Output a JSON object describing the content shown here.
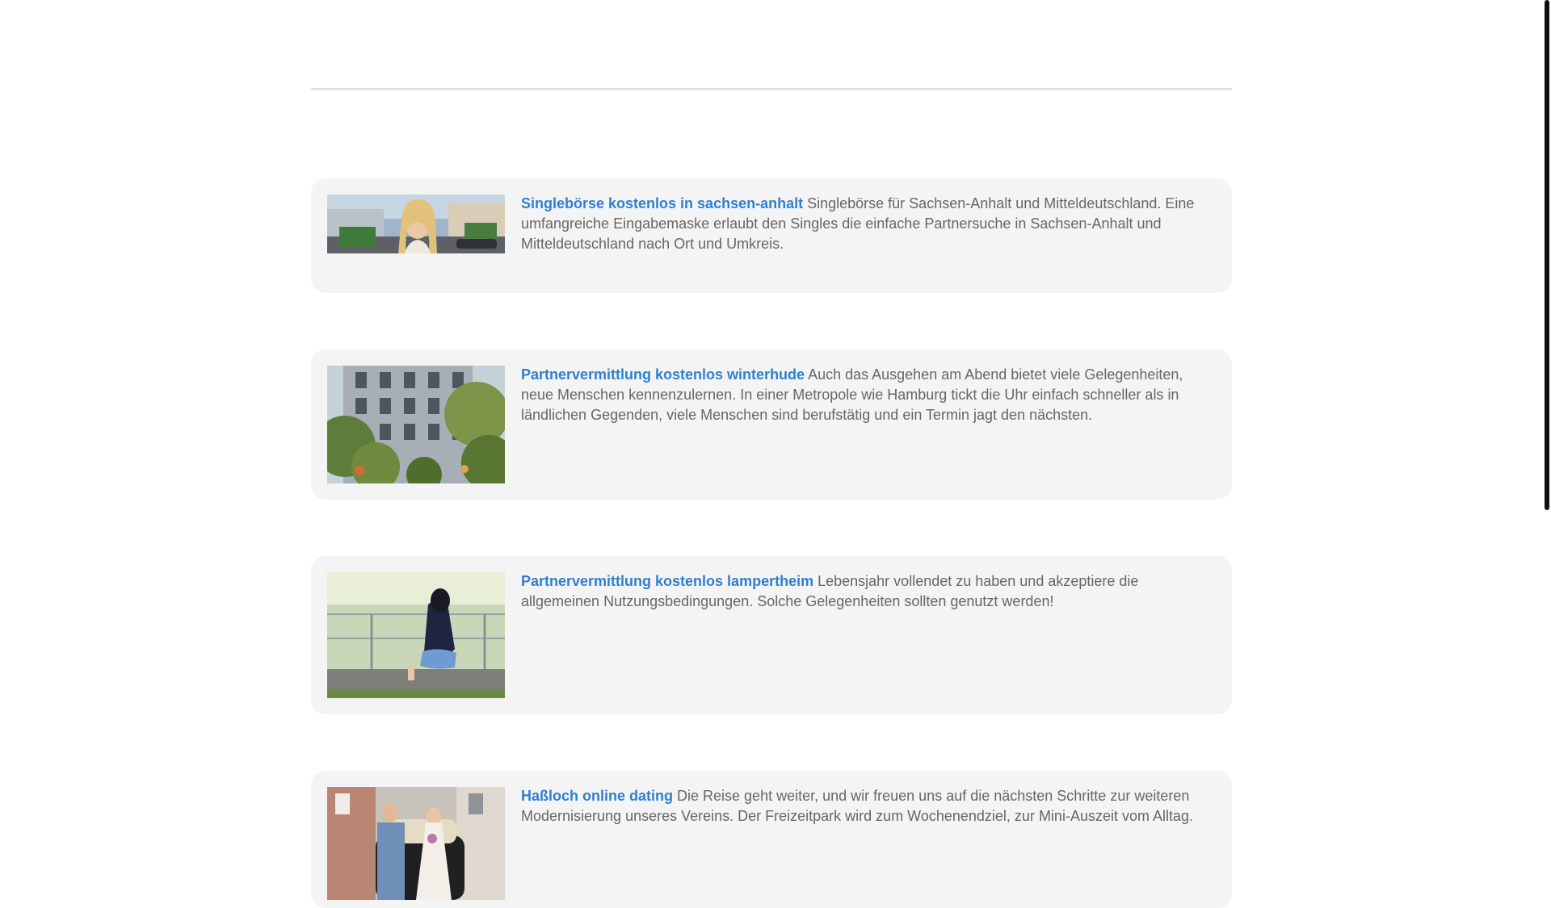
{
  "articles": [
    {
      "title": "Singlebörse kostenlos in sachsen-anhalt",
      "text": "Singlebörse für Sachsen-Anhalt und Mitteldeutschland. Eine umfangreiche Eingabemaske erlaubt den Singles die einfache Partnersuche in Sachsen-Anhalt und Mitteldeutschland nach Ort und Umkreis."
    },
    {
      "title": "Partnervermittlung kostenlos winterhude",
      "text": "Auch das Ausgehen am Abend bietet viele Gelegenheiten, neue Menschen kennenzulernen. In einer Metropole wie Hamburg tickt die Uhr einfach schneller als in ländlichen Gegenden, viele Menschen sind berufstätig und ein Termin jagt den nächsten."
    },
    {
      "title": "Partnervermittlung kostenlos lampertheim",
      "text": "Lebensjahr vollendet zu haben und akzeptiere die allgemeinen Nutzungsbedingungen. Solche Gelegenheiten sollten genutzt werden!"
    },
    {
      "title": "Haßloch online dating",
      "text": "Die Reise geht weiter, und wir freuen uns auf die nächsten Schritte zur weiteren Modernisierung unseres Vereins. Der Freizeitpark wird zum Wochenendziel, zur Mini-Auszeit vom Alltag."
    }
  ],
  "colors": {
    "link": "#2f7fd1",
    "body_text": "#666666",
    "card_bg": "#f4f4f4",
    "divider": "#e3e3e3"
  },
  "icons": {
    "thumbnails": [
      "woman-city-photo",
      "apartment-building-photo",
      "woman-by-lake-photo",
      "wedding-couple-photo"
    ]
  }
}
